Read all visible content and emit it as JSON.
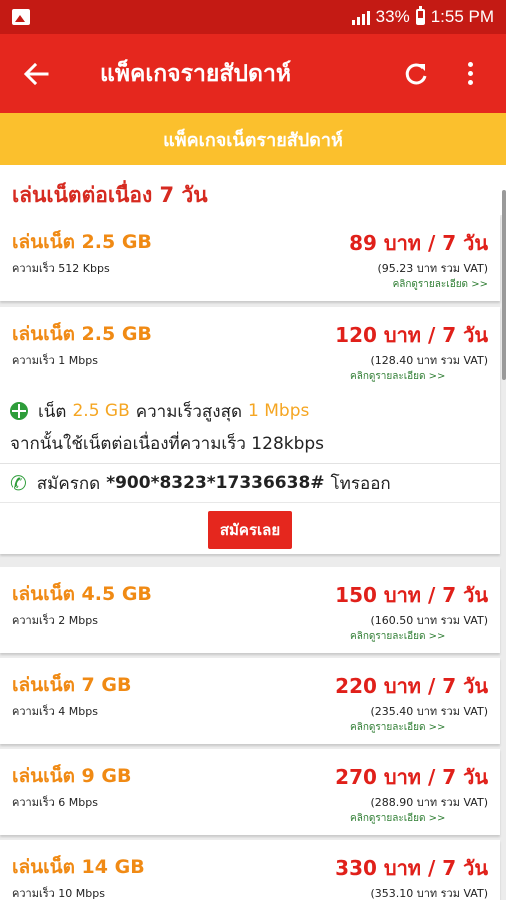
{
  "status": {
    "battery": "33%",
    "time": "1:55 PM"
  },
  "appbar": {
    "title": "แพ็คเกจรายสัปดาห์"
  },
  "banner": {
    "text": "แพ็คเกจเน็ตรายสัปดาห์"
  },
  "section": {
    "title": "เล่นเน็ตต่อเนื่อง 7 วัน"
  },
  "packages": [
    {
      "name": "เล่นเน็ต 2.5 GB",
      "speed": "ความเร็ว 512 Kbps",
      "price": "89 บาท / 7 วัน",
      "vat": "(95.23 บาท รวม VAT)",
      "detail": "คลิกดูรายละเอียด >>"
    },
    {
      "name": "เล่นเน็ต 2.5 GB",
      "speed": "ความเร็ว 1 Mbps",
      "price": "120 บาท / 7 วัน",
      "vat": "(128.40 บาท รวม VAT)",
      "detail": "คลิกดูรายละเอียด >>"
    },
    {
      "name": "เล่นเน็ต 4.5 GB",
      "speed": "ความเร็ว 2 Mbps",
      "price": "150 บาท / 7 วัน",
      "vat": "(160.50 บาท รวม VAT)",
      "detail": "คลิกดูรายละเอียด >>"
    },
    {
      "name": "เล่นเน็ต 7 GB",
      "speed": "ความเร็ว 4 Mbps",
      "price": "220 บาท / 7 วัน",
      "vat": "(235.40 บาท รวม VAT)",
      "detail": "คลิกดูรายละเอียด >>"
    },
    {
      "name": "เล่นเน็ต 9 GB",
      "speed": "ความเร็ว 6 Mbps",
      "price": "270 บาท / 7 วัน",
      "vat": "(288.90 บาท รวม VAT)",
      "detail": "คลิกดูรายละเอียด >>"
    },
    {
      "name": "เล่นเน็ต 14 GB",
      "speed": "ความเร็ว 10 Mbps",
      "price": "330 บาท / 7 วัน",
      "vat": "(353.10 บาท รวม VAT)"
    }
  ],
  "expanded": {
    "line1_prefix": "เน็ต",
    "line1_data": "2.5 GB",
    "line1_middle": "ความเร็วสูงสุด",
    "line1_speed": "1 Mbps",
    "line2": "จากนั้นใช้เน็ตต่อเนื่องที่ความเร็ว 128kbps",
    "dial_prefix": "สมัครกด",
    "dial_code": "*900*8323*17336638#",
    "dial_suffix": "โทรออก",
    "apply_label": "สมัครเลย"
  }
}
